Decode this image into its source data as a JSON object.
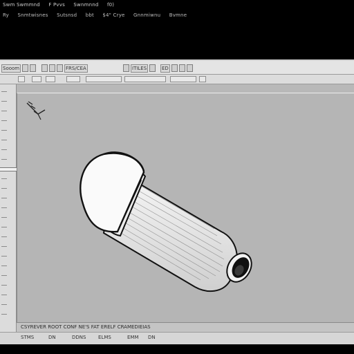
{
  "menu": {
    "row1": [
      "Swm Swmmnd",
      "F Pvvs",
      "Swnmnnd",
      "f0)"
    ],
    "row2": [
      "Ry",
      "Snmtwisnes",
      "Sutsnsd",
      "bbt",
      "$4\" Crye",
      "Gnnmiwnu",
      "Bvmne"
    ]
  },
  "toolbar": {
    "group1": "Sooom",
    "group2": "FRS/CEA",
    "group3": "ITILES",
    "group4": "ED"
  },
  "canvas": {
    "object": "cylindrical-part-with-cap"
  },
  "status": {
    "line1": "CSYREVER ROOT CONF NE'S FAT ERELF CRAMEDIEIAS",
    "seg1": "STMS",
    "seg2": "DN",
    "seg3": "DDNS",
    "seg4": "ELMS",
    "seg5": "EMM",
    "seg6": "DN"
  },
  "colors": {
    "background": "#000000",
    "window": "#b8b8b8",
    "toolbar": "#e4e4e4"
  }
}
